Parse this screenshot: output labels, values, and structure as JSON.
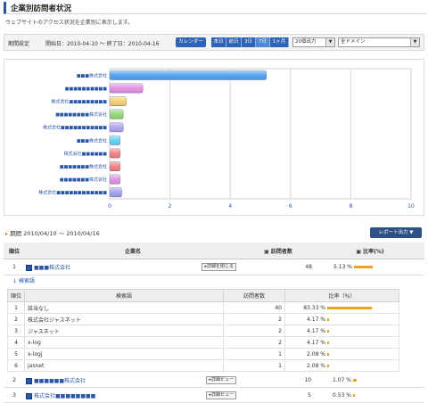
{
  "page": {
    "title": "企業別訪問者状況",
    "description": "ウェブサイトのアクセス状況を企業別に表示します。"
  },
  "filter": {
    "label": "期間設定",
    "dates": "開始日：2010-04-10 ～ 終了日：2010-04-16",
    "calendar_button": "カレンダー",
    "range_buttons": [
      "本日",
      "前日",
      "3日",
      "7日",
      "1ヶ月"
    ],
    "selected_range": "7日",
    "count_select": "20個出力",
    "domain_select": "全ドメイン"
  },
  "chart_data": {
    "type": "bar",
    "orientation": "horizontal",
    "categories": [
      "■■■株式会社",
      "■■■■■■■■■■",
      "株式会社■■■■■■■■■",
      "■■■■■■■■株式会社",
      "株式会社■■■■■■■■■■■",
      "■■■株式会社",
      "株式会社■■■■■■",
      "■■■■■■■株式会社",
      "■■■■■■■株式会社",
      "株式会社■■■■■■■■■■■■"
    ],
    "values": [
      5.2,
      1.1,
      0.55,
      0.45,
      0.45,
      0.35,
      0.35,
      0.35,
      0.35,
      0.4
    ],
    "colors": [
      "#4aa0ee",
      "#e090e0",
      "#f5d070",
      "#90d870",
      "#b0a0f0",
      "#60d0f0",
      "#f08080",
      "#f08080",
      "#e090e0",
      "#a0a0f0"
    ],
    "xlim": [
      0,
      10
    ],
    "xticks": [
      "0",
      "2",
      "4",
      "6",
      "8",
      "10"
    ],
    "grid": true
  },
  "period": {
    "label": "期間",
    "range": "2010/04/10 ～ 2010/04/16",
    "report_button": "レポート出力"
  },
  "main_table": {
    "headers": [
      "順位",
      "企業名",
      "訪問者数",
      "比率(%)"
    ],
    "rows": [
      {
        "rank": "1",
        "company": "■■■株式会社",
        "button": "詳細を閉じる",
        "visitors": "48",
        "ratio": "5.13 %",
        "bar": 0.35
      },
      {
        "rank": "2",
        "company": "■■■■■■株式会社",
        "button": "詳細ビュー",
        "visitors": "10",
        "ratio": "1.07 %",
        "bar": 0.07
      },
      {
        "rank": "3",
        "company": "株式会社■■■■■■■■",
        "button": "詳細ビュー",
        "visitors": "5",
        "ratio": "0.53 %",
        "bar": 0.04
      }
    ]
  },
  "keyword": {
    "title": "検索語",
    "headers": [
      "順位",
      "検索語",
      "訪問者数",
      "比率（%）"
    ],
    "rows": [
      {
        "rank": "1",
        "term": "該当なし",
        "visitors": "40",
        "ratio": "83.33 %",
        "bar": 0.8333
      },
      {
        "rank": "2",
        "term": "株式会社ジャスネット",
        "visitors": "2",
        "ratio": "4.17 %",
        "bar": 0.0417
      },
      {
        "rank": "3",
        "term": "ジャスネット",
        "visitors": "2",
        "ratio": "4.17 %",
        "bar": 0.0417
      },
      {
        "rank": "4",
        "term": "x-log",
        "visitors": "2",
        "ratio": "4.17 %",
        "bar": 0.0417
      },
      {
        "rank": "5",
        "term": "x-logj",
        "visitors": "1",
        "ratio": "2.08 %",
        "bar": 0.0208
      },
      {
        "rank": "6",
        "term": "jasnet",
        "visitors": "1",
        "ratio": "2.08 %",
        "bar": 0.0208
      }
    ]
  }
}
